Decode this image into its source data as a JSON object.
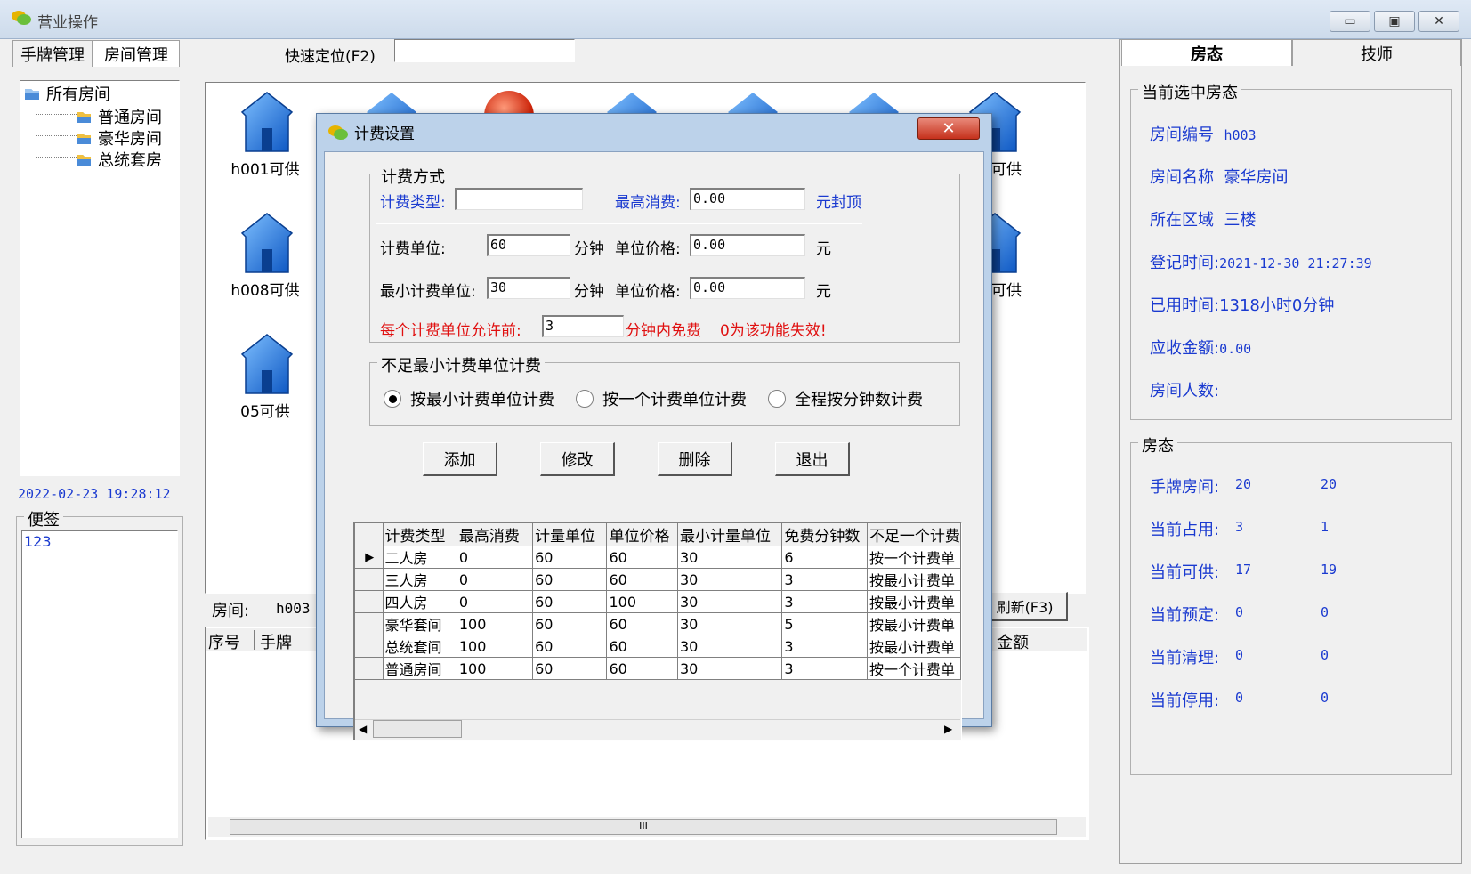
{
  "window": {
    "title": "营业操作",
    "minimize": "▭",
    "maximize": "▣",
    "close": "✕"
  },
  "left_tabs": [
    "手牌管理",
    "房间管理"
  ],
  "quick_locate": {
    "label": "快速定位(F2)",
    "value": ""
  },
  "tree": {
    "root": "所有房间",
    "children": [
      "普通房间",
      "豪华房间",
      "总统套房"
    ]
  },
  "datetime": "2022-02-23 19:28:12",
  "memo": {
    "title": "便签",
    "text": "123"
  },
  "rooms": [
    {
      "label": "h001可供"
    },
    {
      "label": "h008可供"
    },
    {
      "label": "05可供"
    },
    {
      "label": "可供"
    },
    {
      "label": "可供"
    }
  ],
  "room_bar": {
    "label": "房间:",
    "value": "h003",
    "refresh": "刷新(F3)"
  },
  "bottom_table": {
    "headers": [
      "序号",
      "手牌"
    ],
    "amount_header": "金额",
    "scroll_mark": "III"
  },
  "dialog": {
    "title": "计费设置",
    "close": "✕",
    "group1": "计费方式",
    "fee_type_label": "计费类型:",
    "fee_type_value": "",
    "max_fee_label": "最高消费:",
    "max_fee_value": "0.00",
    "max_fee_suffix": "元封顶",
    "unit_label": "计费单位:",
    "unit_value": "60",
    "unit_suffix": "分钟",
    "unit_price_label": "单位价格:",
    "unit_price_value": "0.00",
    "unit_price_suffix": "元",
    "min_unit_label": "最小计费单位:",
    "min_unit_value": "30",
    "min_unit_suffix": "分钟",
    "min_price_label": "单位价格:",
    "min_price_value": "0.00",
    "min_price_suffix": "元",
    "free_label": "每个计费单位允许前:",
    "free_value": "3",
    "free_suffix": "分钟内免费",
    "free_note": "0为该功能失效!",
    "group2": "不足最小计费单位计费",
    "radios": [
      {
        "label": "按最小计费单位计费",
        "checked": true
      },
      {
        "label": "按一个计费单位计费",
        "checked": false
      },
      {
        "label": "全程按分钟数计费",
        "checked": false
      }
    ],
    "buttons": [
      "添加",
      "修改",
      "删除",
      "退出"
    ],
    "grid": {
      "headers": [
        "计费类型",
        "最高消费",
        "计量单位",
        "单位价格",
        "最小计量单位",
        "免费分钟数",
        "不足一个计费"
      ],
      "rows": [
        [
          "二人房",
          "0",
          "60",
          "60",
          "30",
          "6",
          "按一个计费单"
        ],
        [
          "三人房",
          "0",
          "60",
          "60",
          "30",
          "3",
          "按最小计费单"
        ],
        [
          "四人房",
          "0",
          "60",
          "100",
          "30",
          "3",
          "按最小计费单"
        ],
        [
          "豪华套间",
          "100",
          "60",
          "60",
          "30",
          "5",
          "按最小计费单"
        ],
        [
          "总统套间",
          "100",
          "60",
          "60",
          "30",
          "3",
          "按最小计费单"
        ],
        [
          "普通房间",
          "100",
          "60",
          "60",
          "30",
          "3",
          "按一个计费单"
        ]
      ],
      "current_row_marker": "▶"
    }
  },
  "right_tabs": [
    "房态",
    "技师"
  ],
  "selected": {
    "title": "当前选中房态",
    "rows": [
      {
        "label": "房间编号",
        "value": "h003"
      },
      {
        "label": "房间名称",
        "value": "豪华房间"
      },
      {
        "label": "所在区域",
        "value": "三楼"
      },
      {
        "label": "登记时间:",
        "value": "2021-12-30 21:27:39"
      },
      {
        "label": "已用时间:",
        "value": "1318小时0分钟"
      },
      {
        "label": "应收金额:",
        "value": "0.00"
      },
      {
        "label": "房间人数:",
        "value": ""
      }
    ]
  },
  "status": {
    "title": "房态",
    "rows": [
      {
        "label": "手牌房间:",
        "a": "20",
        "b": "20"
      },
      {
        "label": "当前占用:",
        "a": "3",
        "b": "1"
      },
      {
        "label": "当前可供:",
        "a": "17",
        "b": "19"
      },
      {
        "label": "当前预定:",
        "a": "0",
        "b": "0"
      },
      {
        "label": "当前清理:",
        "a": "0",
        "b": "0"
      },
      {
        "label": "当前停用:",
        "a": "0",
        "b": "0"
      }
    ]
  },
  "colors": {
    "accent_blue": "#1a3ad0",
    "warn_red": "#e01010",
    "house_blue": "#1e6fd6"
  }
}
